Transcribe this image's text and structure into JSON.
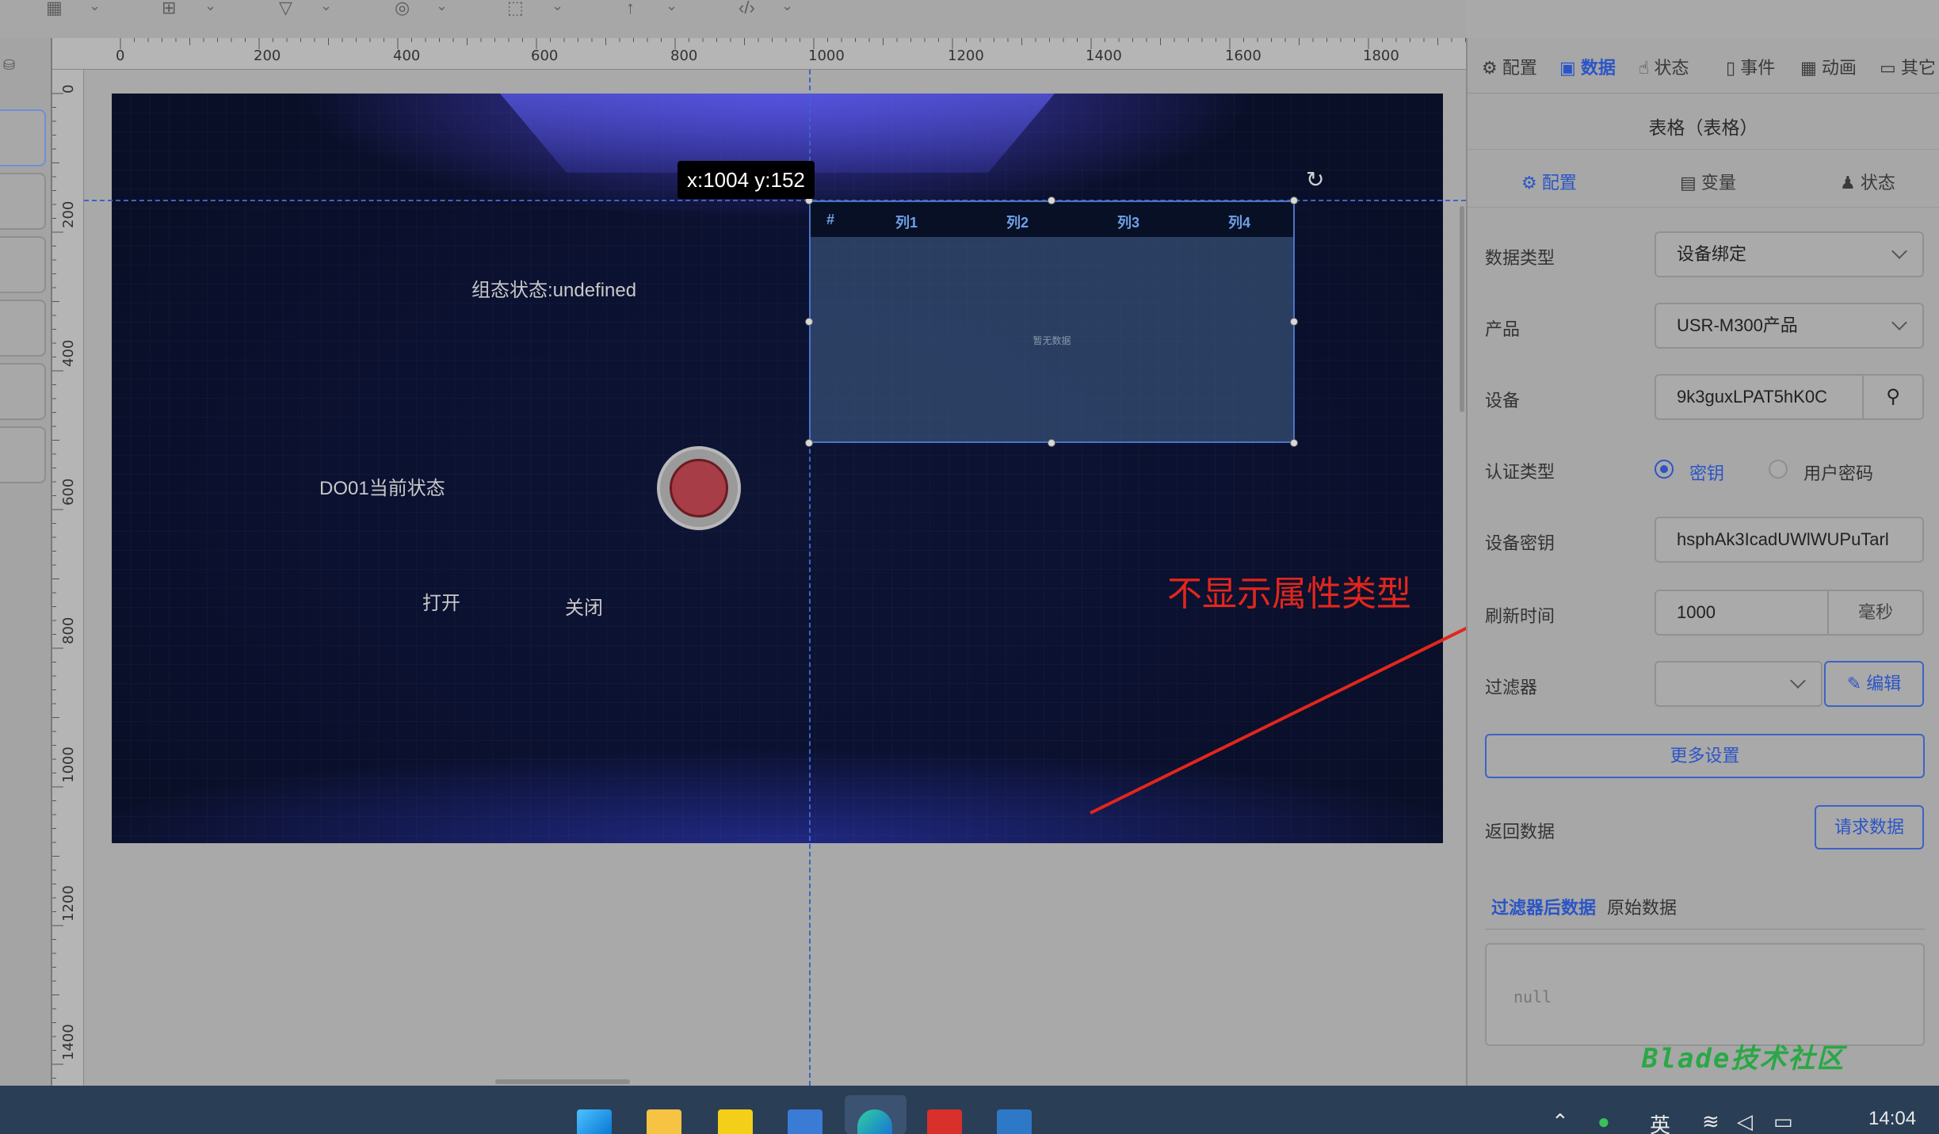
{
  "toolbar": {
    "icons": [
      "grid-icon",
      "table-icon",
      "pen-icon",
      "shapes-icon",
      "select-icon",
      "pin-icon",
      "code-icon"
    ]
  },
  "ruler": {
    "top_labels": [
      "0",
      "200",
      "400",
      "600",
      "800",
      "1000",
      "1200",
      "1400",
      "1600",
      "1800"
    ],
    "left_labels": [
      "0",
      "200",
      "400",
      "600",
      "800",
      "1000",
      "1200",
      "1400"
    ]
  },
  "canvas": {
    "coord_tooltip": "x:1004 y:152",
    "status_text": "组态状态:undefined",
    "do_label": "DO01当前状态",
    "open_label": "打开",
    "close_label": "关闭",
    "table": {
      "columns": [
        "#",
        "列1",
        "列2",
        "列3",
        "列4"
      ],
      "empty_text": "暂无数据"
    },
    "annotation_text": "不显示属性类型"
  },
  "right_panel": {
    "tabs": [
      {
        "label": "配置",
        "icon": "gear-icon"
      },
      {
        "label": "数据",
        "icon": "data-icon",
        "active": true
      },
      {
        "label": "状态",
        "icon": "pointer-icon"
      },
      {
        "label": "事件",
        "icon": "event-icon"
      },
      {
        "label": "动画",
        "icon": "grid-icon"
      },
      {
        "label": "其它",
        "icon": "folder-icon"
      }
    ],
    "title": "表格（表格）",
    "sub_tabs": [
      {
        "label": "配置",
        "active": true
      },
      {
        "label": "变量"
      },
      {
        "label": "状态"
      }
    ],
    "fields": {
      "data_type_label": "数据类型",
      "data_type_value": "设备绑定",
      "product_label": "产品",
      "product_value": "USR-M300产品",
      "device_label": "设备",
      "device_value": "9k3guxLPAT5hK0C",
      "auth_label": "认证类型",
      "auth_option_key": "密钥",
      "auth_option_pwd": "用户密码",
      "secret_label": "设备密钥",
      "secret_value": "hsphAk3IcadUWlWUPuTarl",
      "refresh_label": "刷新时间",
      "refresh_value": "1000",
      "refresh_unit": "毫秒",
      "filter_label": "过滤器",
      "filter_value": "",
      "edit_button": "编辑"
    },
    "more_settings": "更多设置",
    "return_label": "返回数据",
    "request_button": "请求数据",
    "data_tabs": [
      "过滤器后数据",
      "原始数据"
    ],
    "code_value": "null"
  },
  "watermark": "Blade技术社区",
  "taskbar": {
    "lang": "英",
    "time": "14:04"
  },
  "colors": {
    "accent": "#2b55c7",
    "annotation": "#e3261c",
    "canvas_bg": "#0b1130",
    "watermark": "#29a846"
  }
}
